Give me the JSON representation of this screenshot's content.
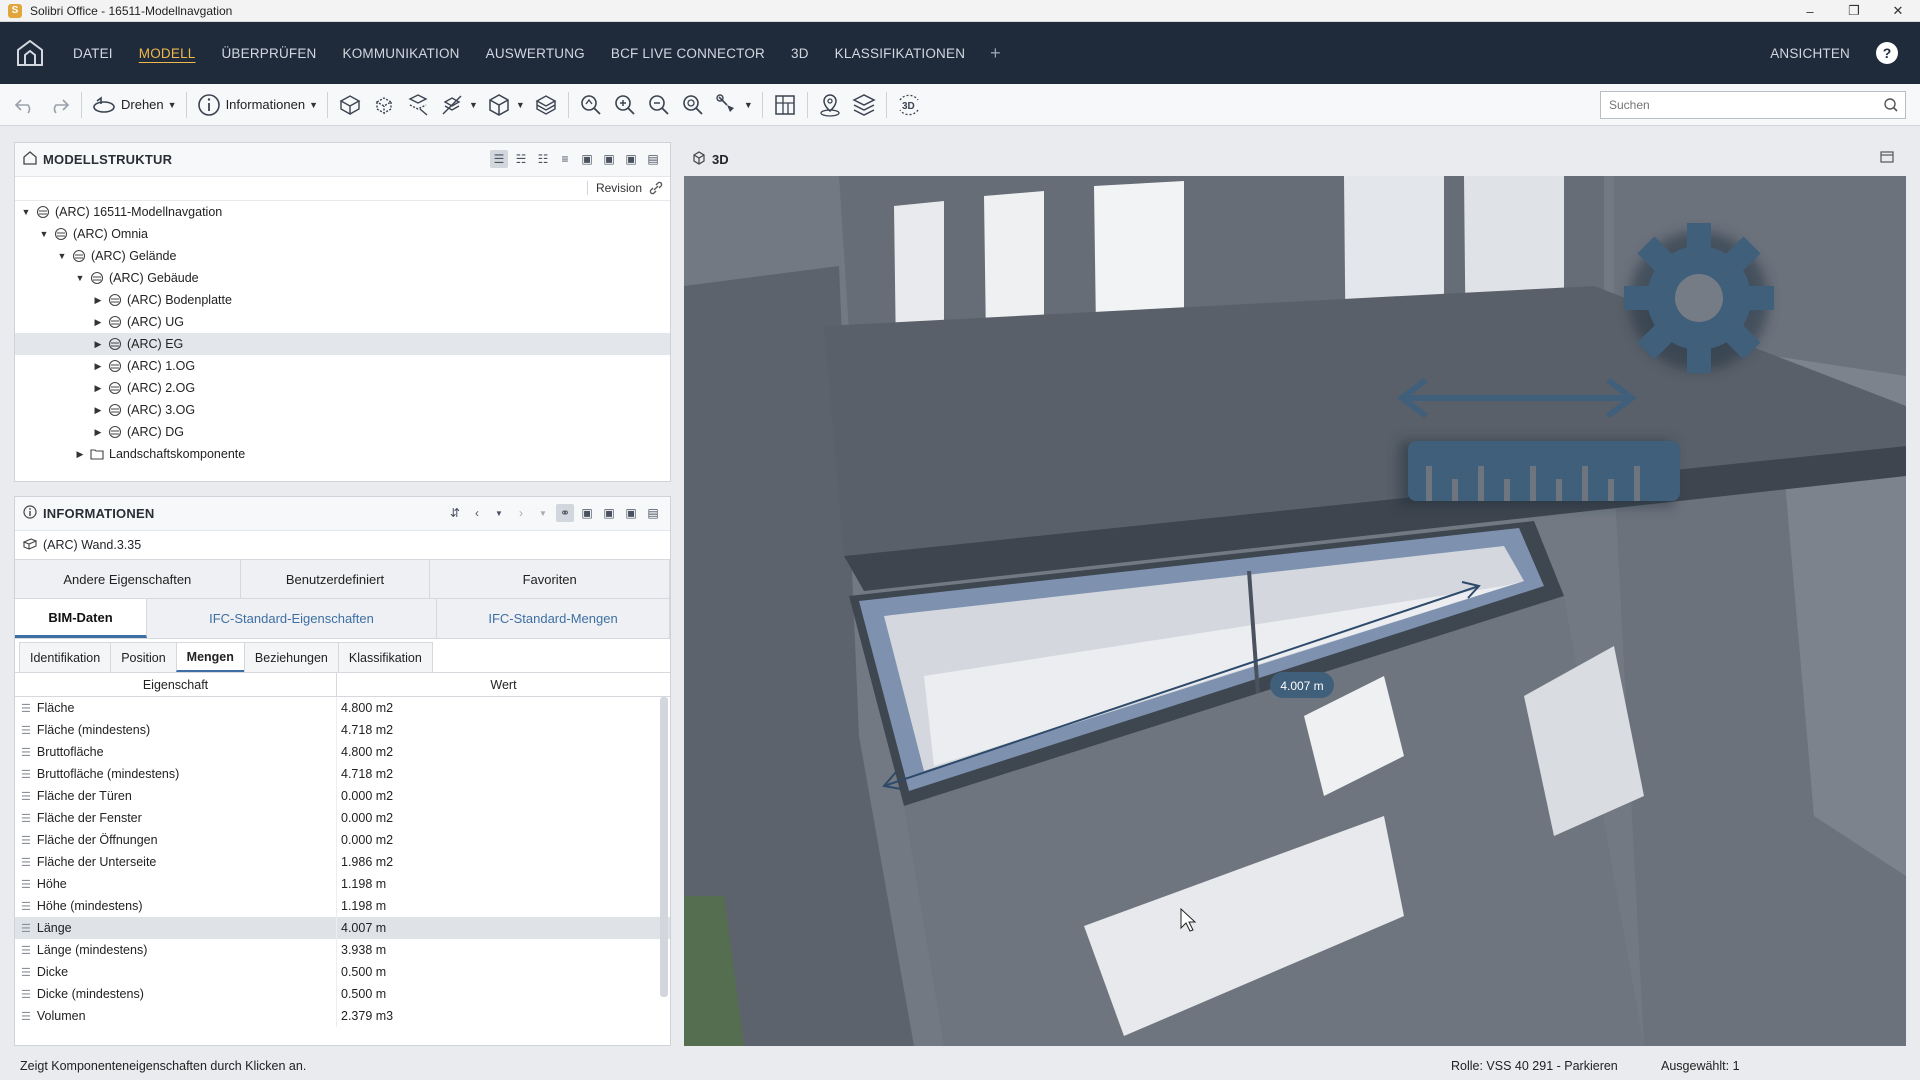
{
  "window": {
    "title": "Solibri Office - 16511-Modellnavgation",
    "app_badge": "S"
  },
  "menu": {
    "items": [
      "DATEI",
      "MODELL",
      "ÜBERPRÜFEN",
      "KOMMUNIKATION",
      "AUSWERTUNG",
      "BCF LIVE CONNECTOR",
      "3D",
      "KLASSIFIKATIONEN"
    ],
    "active": "MODELL",
    "views_label": "ANSICHTEN",
    "help_label": "?"
  },
  "toolbar": {
    "rotate_label": "Drehen",
    "info_label": "Informationen",
    "search_placeholder": "Suchen"
  },
  "structure": {
    "title": "MODELLSTRUKTUR",
    "revision_label": "Revision",
    "tree": [
      {
        "label": "(ARC) 16511-Modellnavgation",
        "expanded": true
      },
      {
        "label": "(ARC) Omnia",
        "expanded": true
      },
      {
        "label": "(ARC) Gelände",
        "expanded": true
      },
      {
        "label": "(ARC) Gebäude",
        "expanded": true
      },
      {
        "label": "(ARC) Bodenplatte",
        "expanded": false
      },
      {
        "label": "(ARC) UG",
        "expanded": false
      },
      {
        "label": "(ARC) EG",
        "expanded": false,
        "selected": true
      },
      {
        "label": "(ARC) 1.OG",
        "expanded": false
      },
      {
        "label": "(ARC) 2.OG",
        "expanded": false
      },
      {
        "label": "(ARC) 3.OG",
        "expanded": false
      },
      {
        "label": "(ARC) DG",
        "expanded": false
      },
      {
        "label": "Landschaftskomponente",
        "expanded": false
      }
    ]
  },
  "info": {
    "title": "INFORMATIONEN",
    "object": "(ARC) Wand.3.35",
    "tabs_top": [
      "Andere Eigenschaften",
      "Benutzerdefiniert",
      "Favoriten"
    ],
    "tabs_mid": [
      "BIM-Daten",
      "IFC-Standard-Eigenschaften",
      "IFC-Standard-Mengen"
    ],
    "tabs_mid_active": "BIM-Daten",
    "tabs_sub": [
      "Identifikation",
      "Position",
      "Mengen",
      "Beziehungen",
      "Klassifikation"
    ],
    "tabs_sub_active": "Mengen",
    "col_property": "Eigenschaft",
    "col_value": "Wert",
    "rows": [
      {
        "name": "Fläche",
        "value": "4.800 m2"
      },
      {
        "name": "Fläche (mindestens)",
        "value": "4.718 m2"
      },
      {
        "name": "Bruttofläche",
        "value": "4.800 m2"
      },
      {
        "name": "Bruttofläche (mindestens)",
        "value": "4.718 m2"
      },
      {
        "name": "Fläche der Türen",
        "value": "0.000 m2"
      },
      {
        "name": "Fläche der Fenster",
        "value": "0.000 m2"
      },
      {
        "name": "Fläche der Öffnungen",
        "value": "0.000 m2"
      },
      {
        "name": "Fläche der Unterseite",
        "value": "1.986 m2"
      },
      {
        "name": "Höhe",
        "value": "1.198 m"
      },
      {
        "name": "Höhe (mindestens)",
        "value": "1.198 m"
      },
      {
        "name": "Länge",
        "value": "4.007 m",
        "selected": true
      },
      {
        "name": "Länge (mindestens)",
        "value": "3.938 m"
      },
      {
        "name": "Dicke",
        "value": "0.500 m"
      },
      {
        "name": "Dicke (mindestens)",
        "value": "0.500 m"
      },
      {
        "name": "Volumen",
        "value": "2.379 m3"
      }
    ]
  },
  "viewport": {
    "title": "3D",
    "measure_label": "4.007 m",
    "accent": "#3f5f7a"
  },
  "status": {
    "message": "Zeigt Komponenteneigenschaften durch Klicken an.",
    "role": "Rolle: VSS 40 291 - Parkieren",
    "selected": "Ausgewählt: 1"
  }
}
